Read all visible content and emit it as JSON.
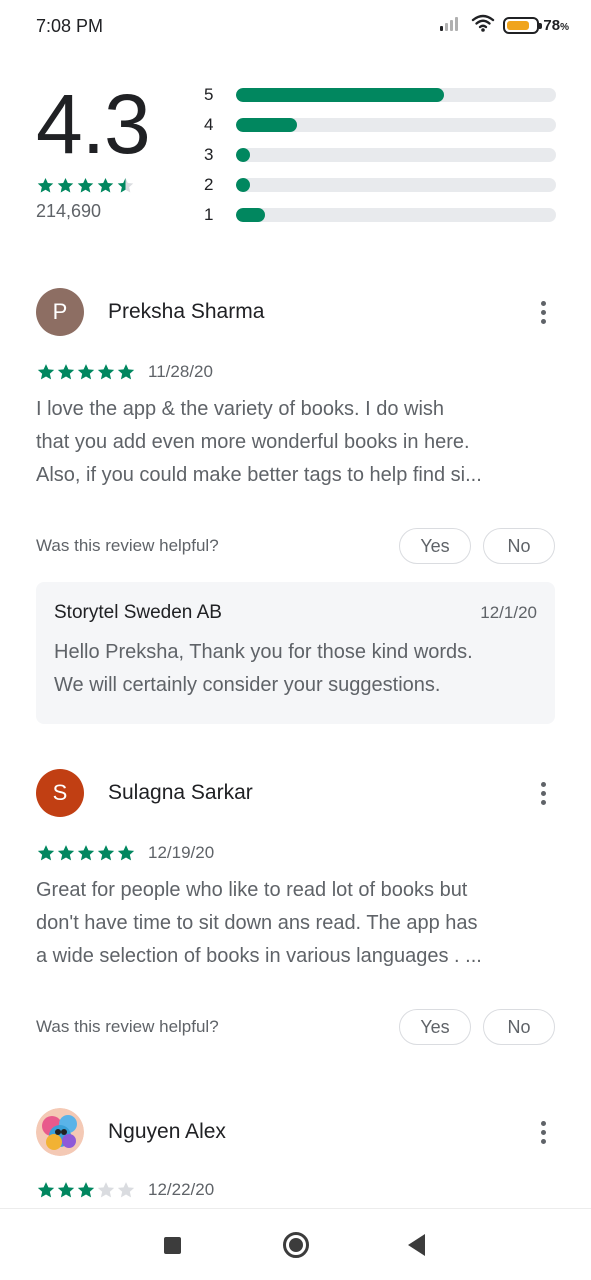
{
  "status_bar": {
    "time": "7:08 PM",
    "battery_percent": "78",
    "battery_unit": "%",
    "battery_level": 0.78,
    "icons": [
      "signal-icon",
      "wifi-icon",
      "battery-icon"
    ]
  },
  "colors": {
    "accent": "#01875f",
    "track": "#e8eaed",
    "empty_star": "#dadce0"
  },
  "summary": {
    "rating": "4.3",
    "stars": 4.5,
    "total_reviews": "214,690",
    "histogram": [
      {
        "label": "5",
        "fraction": 0.65
      },
      {
        "label": "4",
        "fraction": 0.19
      },
      {
        "label": "3",
        "fraction": 0.045
      },
      {
        "label": "2",
        "fraction": 0.045
      },
      {
        "label": "1",
        "fraction": 0.09
      }
    ]
  },
  "reviews": [
    {
      "name": "Preksha Sharma",
      "avatar_letter": "P",
      "avatar_color": "#8d6e63",
      "stars": 5,
      "date": "11/28/20",
      "text_lines": [
        "I love the app & the variety of books. I do wish",
        "that you add even more wonderful books in here.",
        "Also, if you could make better tags to help find si..."
      ],
      "helpful_question": "Was this review helpful?",
      "yes_label": "Yes",
      "no_label": "No",
      "reply": {
        "developer": "Storytel Sweden AB",
        "date": "12/1/20",
        "text_lines": [
          "Hello Preksha, Thank you for those kind words.",
          "We will certainly consider your suggestions."
        ]
      }
    },
    {
      "name": "Sulagna Sarkar",
      "avatar_letter": "S",
      "avatar_color": "#c13f13",
      "stars": 5,
      "date": "12/19/20",
      "text_lines": [
        "Great for people who like to read lot of books but",
        "don't have time to sit down ans read. The app has",
        "a wide selection of books in various languages . ..."
      ],
      "helpful_question": "Was this review helpful?",
      "yes_label": "Yes",
      "no_label": "No"
    },
    {
      "name": "Nguyen Alex",
      "stars": 3,
      "date": "12/22/20"
    }
  ],
  "nav_bar": {
    "icons": [
      "recents-square-icon",
      "home-circle-icon",
      "back-triangle-icon"
    ]
  }
}
